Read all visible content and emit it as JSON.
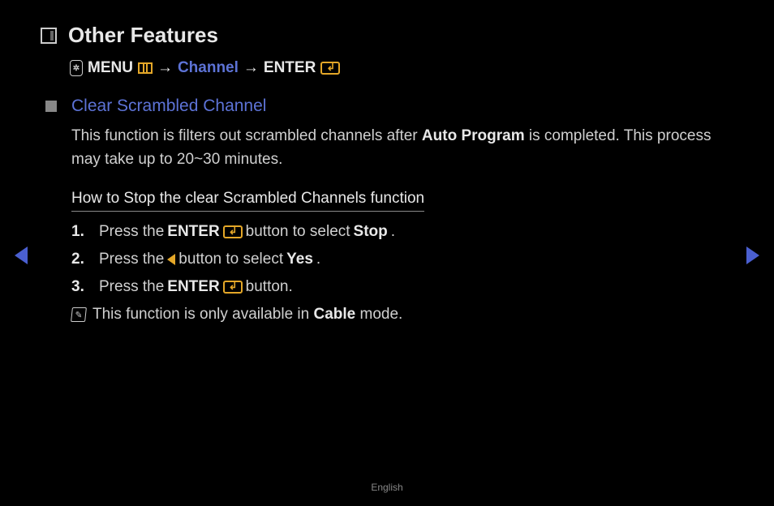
{
  "title": "Other Features",
  "breadcrumb": {
    "menu": "MENU",
    "channel": "Channel",
    "enter": "ENTER"
  },
  "section": {
    "heading": "Clear Scrambled Channel",
    "desc_p1": "This function is filters out scrambled channels after ",
    "desc_link": "Auto Program",
    "desc_p2": " is completed. This process may take up to 20~30 minutes."
  },
  "subheading": "How to Stop the clear Scrambled Channels function",
  "steps": {
    "s1": {
      "num": "1.",
      "a": "Press the ",
      "b": "ENTER",
      "c": " button to select ",
      "d": "Stop",
      "e": "."
    },
    "s2": {
      "num": "2.",
      "a": "Press the ",
      "b": " button to select ",
      "c": "Yes",
      "d": "."
    },
    "s3": {
      "num": "3.",
      "a": "Press the ",
      "b": "ENTER",
      "c": " button."
    }
  },
  "note": {
    "a": "This function is only available in ",
    "b": "Cable",
    "c": " mode."
  },
  "footer": "English"
}
